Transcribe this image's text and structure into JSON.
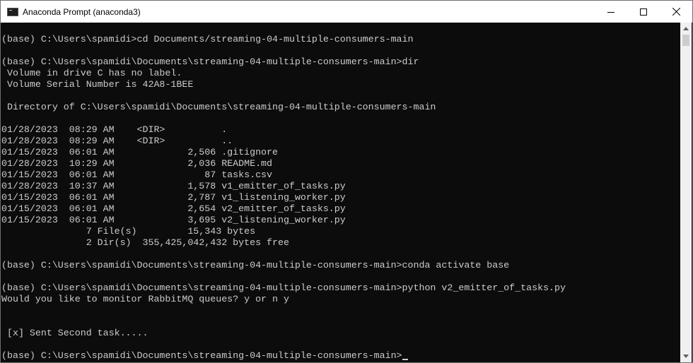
{
  "window": {
    "title": "Anaconda Prompt (anaconda3)"
  },
  "console": {
    "lines": [
      "",
      "(base) C:\\Users\\spamidi>cd Documents/streaming-04-multiple-consumers-main",
      "",
      "(base) C:\\Users\\spamidi\\Documents\\streaming-04-multiple-consumers-main>dir",
      " Volume in drive C has no label.",
      " Volume Serial Number is 42A8-1BEE",
      "",
      " Directory of C:\\Users\\spamidi\\Documents\\streaming-04-multiple-consumers-main",
      "",
      "01/28/2023  08:29 AM    <DIR>          .",
      "01/28/2023  08:29 AM    <DIR>          ..",
      "01/15/2023  06:01 AM             2,506 .gitignore",
      "01/28/2023  10:29 AM             2,036 README.md",
      "01/15/2023  06:01 AM                87 tasks.csv",
      "01/28/2023  10:37 AM             1,578 v1_emitter_of_tasks.py",
      "01/15/2023  06:01 AM             2,787 v1_listening_worker.py",
      "01/15/2023  06:01 AM             2,654 v2_emitter_of_tasks.py",
      "01/15/2023  06:01 AM             3,695 v2_listening_worker.py",
      "               7 File(s)         15,343 bytes",
      "               2 Dir(s)  355,425,042,432 bytes free",
      "",
      "(base) C:\\Users\\spamidi\\Documents\\streaming-04-multiple-consumers-main>conda activate base",
      "",
      "(base) C:\\Users\\spamidi\\Documents\\streaming-04-multiple-consumers-main>python v2_emitter_of_tasks.py",
      "Would you like to monitor RabbitMQ queues? y or n y",
      "",
      "",
      " [x] Sent Second task.....",
      "",
      "(base) C:\\Users\\spamidi\\Documents\\streaming-04-multiple-consumers-main>"
    ]
  }
}
